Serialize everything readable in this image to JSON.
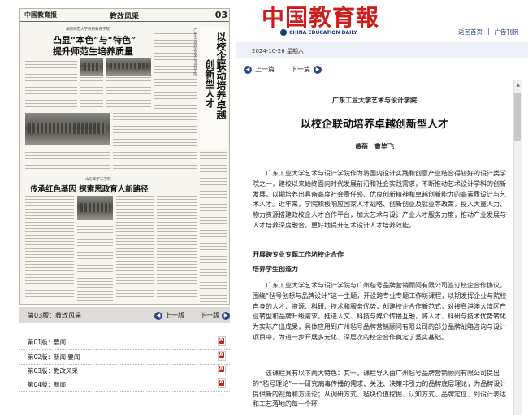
{
  "masthead": {
    "title": "中国教育報",
    "subtitle": "CHINA EDUCATION DAILY"
  },
  "top_nav": {
    "home": "返回首页",
    "gazette": "广告刊例"
  },
  "date_bar": {
    "date": "2024-10-26 星期六"
  },
  "newspaper_page": {
    "paper": "中国教育报",
    "section": "教改风采",
    "page_number": "03",
    "story1_kicker": "湖南师范大学教师教育学院",
    "story1_title_line1": "凸显“本色”与“特色”",
    "story1_title_line2": "提升师范生培养质量",
    "vertical_title_col1": "以校企联动培养卓越",
    "vertical_title_col2": "创新型人才",
    "vertical_kicker": "广东工业大学艺术与设计学院",
    "story2_kicker": "山东华宇工学院",
    "story2_title": "传承红色基因 探索思政育人新路径"
  },
  "section_bar": {
    "label": "第03版：教改风采",
    "prev": "上一版",
    "next": "下一版"
  },
  "editions": [
    {
      "label": "第01版：要闻"
    },
    {
      "label": "第02版：新闻·要闻"
    },
    {
      "label": "第03版：教改风采"
    },
    {
      "label": "第04版：新闻"
    }
  ],
  "article_nav": {
    "prev": "上一篇",
    "next": "下一篇"
  },
  "article": {
    "pre_title": "广东工业大学艺术与设计学院",
    "title": "以校企联动培养卓越创新型人才",
    "authors": "黄蓓　曹毕飞",
    "para1": "广东工业大学艺术与设计学院作为将国内设计实践和创意产业结合得较好的设计类学院之一，建校以来始终面向时代发展前沿和社会实践需求，不断推动艺术设计学科的创新发展，以期培养出具备高度社会责任感、优良创新精神和卓越创新能力的高素质设计与艺术人才。近年来，学院积极响应国家人才战略、创新创业及就业等政策，投入大量人力、物力资源搭建政校企人才合作平台，加大艺术与设计产业人才服务力度，推动产业发展与人才培养深度融合，更好地提升艺术设计人才培养效能。",
    "heading1": "开展跨专业专题工作坊校企合作",
    "heading2": "培养学生创造力",
    "para2": "广东工业大学艺术与设计学院与广州毡号品牌营销顾问有限公司签订校企合作协议，围绕“毡号创想与品牌设计”这一主题，开设跨专业专题工作坊课程，以期发挥企业与院校自身的人才、资源、科研、技术和服务优势，创建校企合作新范式，对接粤港澳大湾区产业转型和品牌升级需求，推进人文、科技与媒介传播互融，将人才、科研与技术优势转化为实际产出成果，具体应用到广州毡号品牌营销顾问有限公司的部分品牌战略咨询与设计项目中，为进一步开展多元化、深层次的校企合作奠定了坚实基础。",
    "para3": "该课程具有以下两大特色：其一，课程导入由广州毡号品牌营销顾问有限公司提出的“毡号理论”——研究病毒传播的需求、关注、决策非引力的品牌底层理论，为品牌设计提供新的视角和方法论；从调研方式、毡块价值挖掘、认知方式、品牌定位、到设计表达和工艺落地的每一个环"
  }
}
